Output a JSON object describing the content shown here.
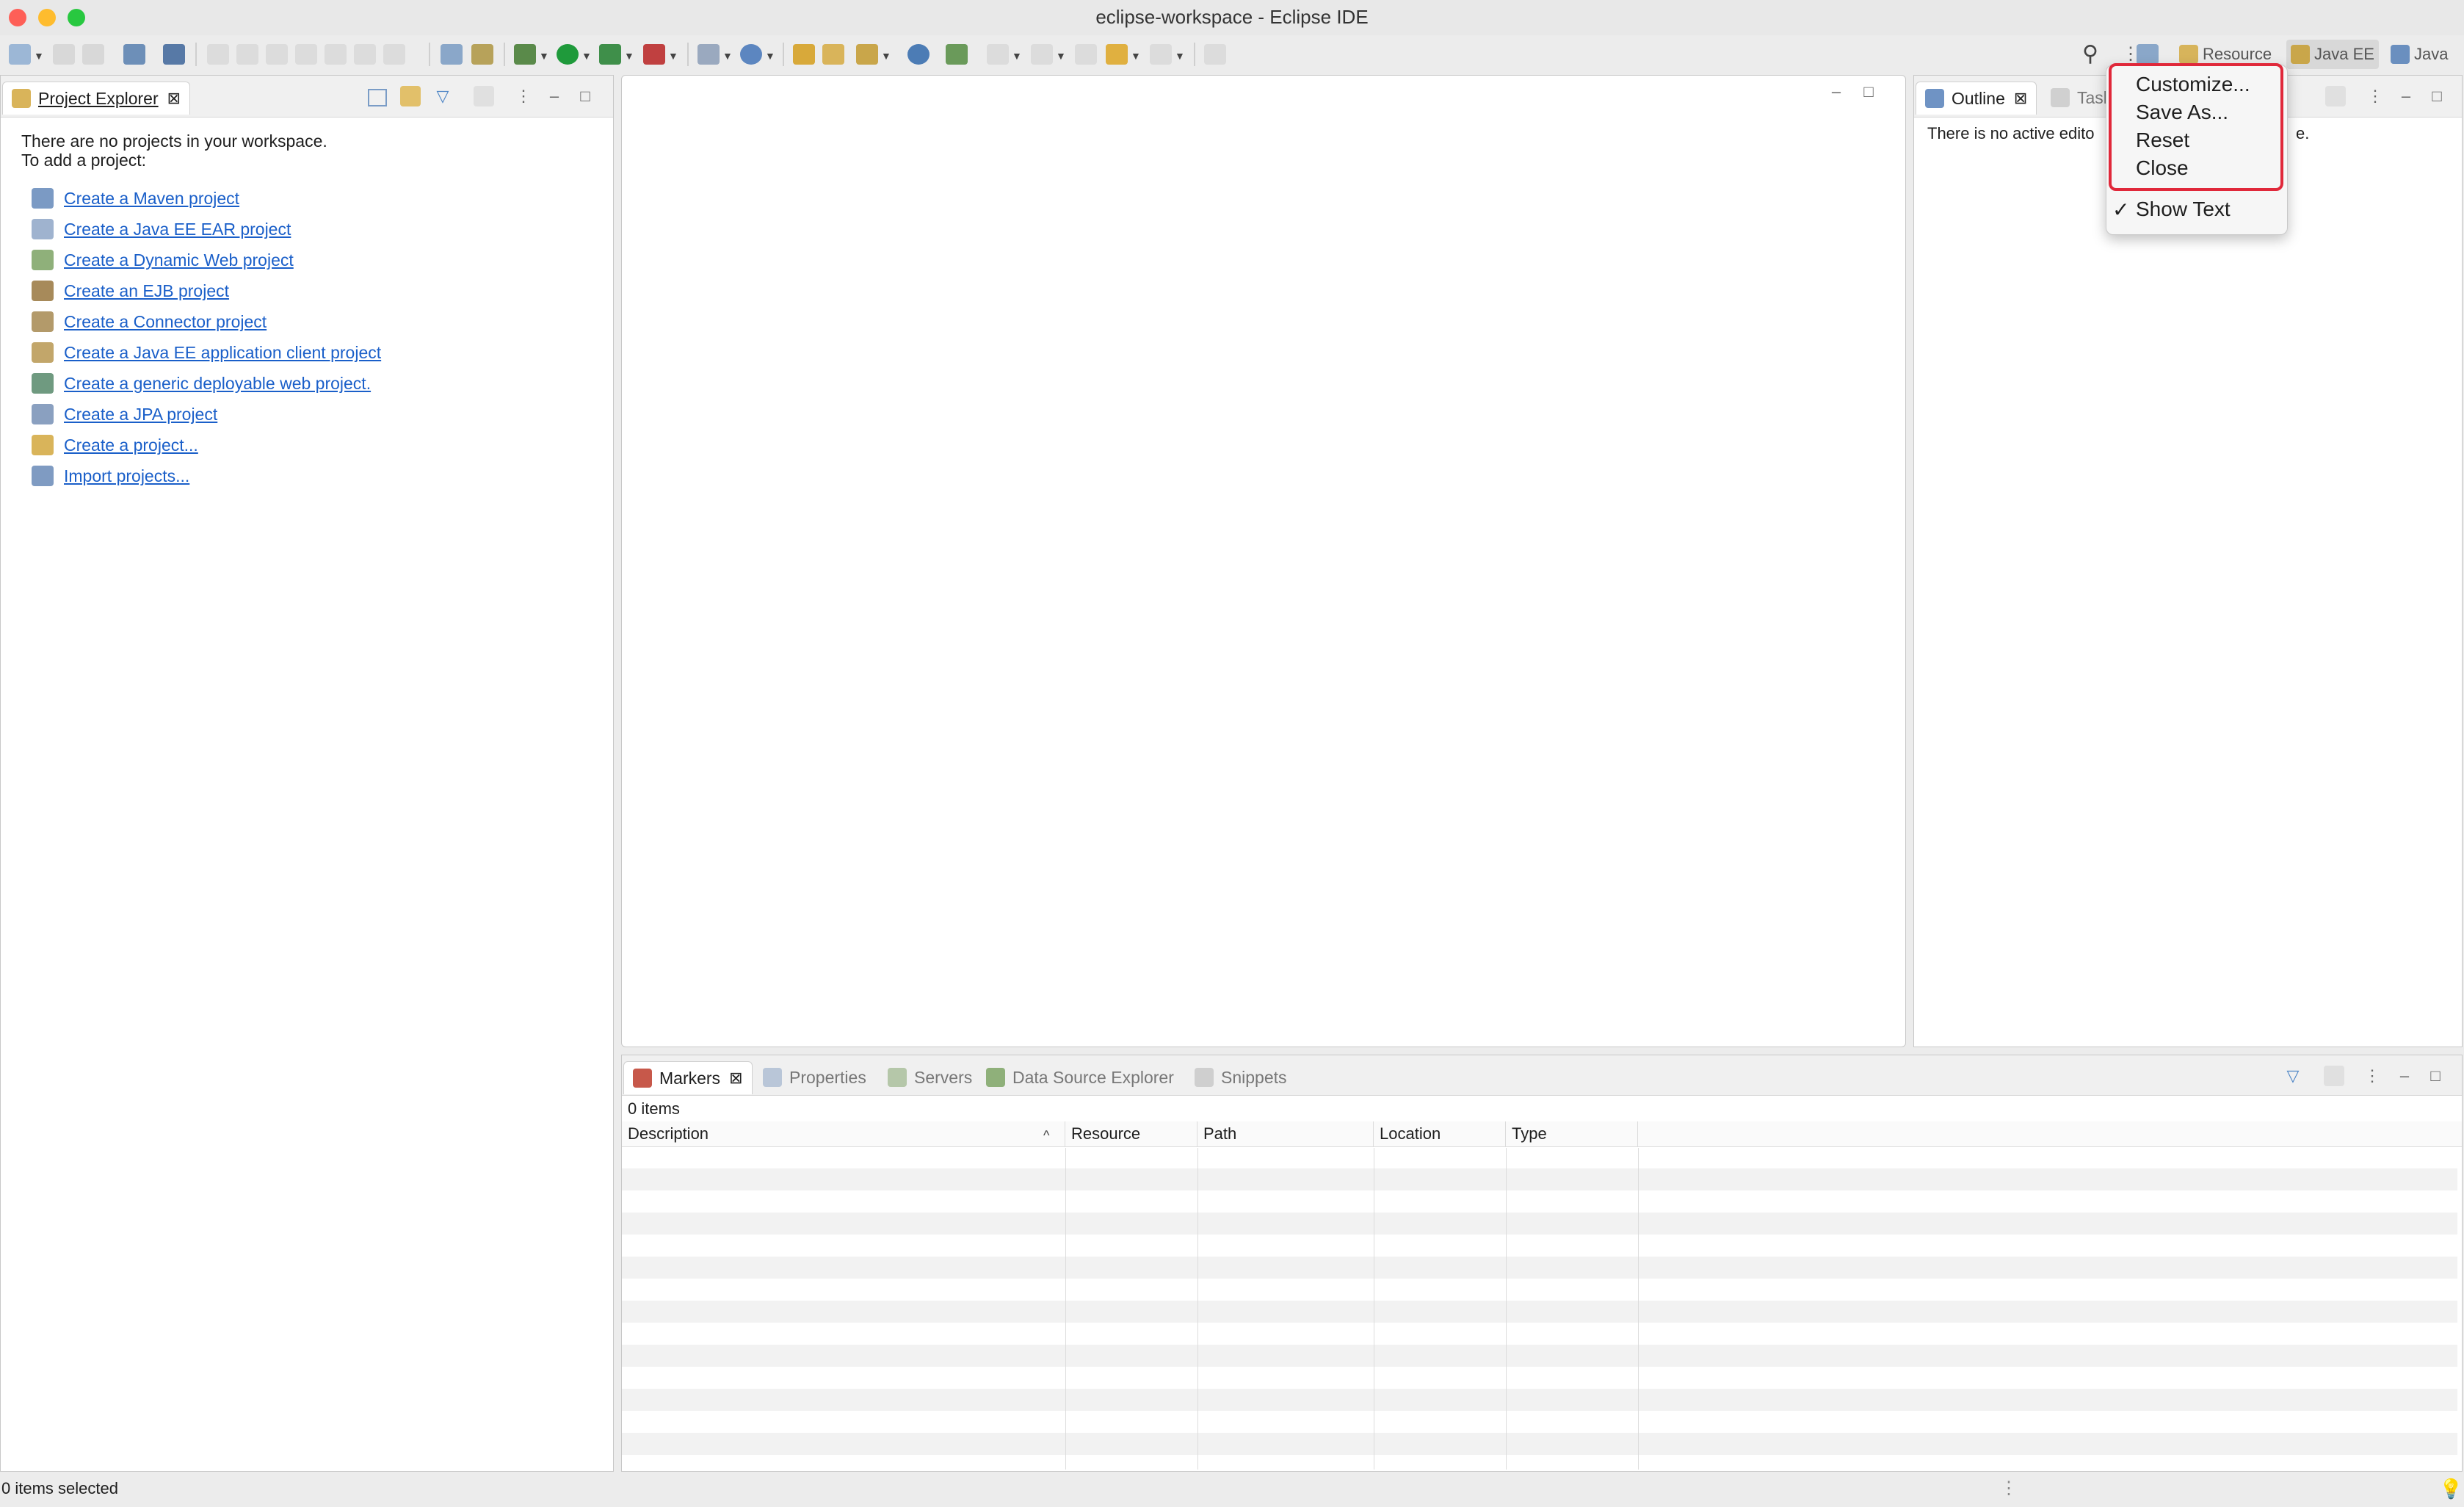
{
  "window": {
    "title": "eclipse-workspace - Eclipse IDE"
  },
  "perspectives": {
    "items": [
      {
        "label": "Resource",
        "icon": "resource-perspective-icon",
        "active": false
      },
      {
        "label": "Java EE",
        "icon": "javaee-perspective-icon",
        "active": true
      },
      {
        "label": "Java",
        "icon": "java-perspective-icon",
        "active": false
      }
    ]
  },
  "context_menu": {
    "items": [
      {
        "label": "Customize..."
      },
      {
        "label": "Save As..."
      },
      {
        "label": "Reset"
      },
      {
        "label": "Close"
      }
    ],
    "show_text": {
      "check": "✓",
      "label": "Show Text"
    }
  },
  "project_explorer": {
    "tab_label": "Project Explorer",
    "close_glyph": "⊠",
    "message_line1": "There are no projects in your workspace.",
    "message_line2": "To add a project:",
    "links": [
      "Create a Maven project",
      "Create a Java EE EAR project",
      "Create a Dynamic Web project",
      "Create an EJB project",
      "Create a Connector project",
      "Create a Java EE application client project",
      "Create a generic deployable web project.",
      "Create a JPA project",
      "Create a project...",
      "Import projects..."
    ]
  },
  "outline": {
    "tab_label": "Outline",
    "second_tab_label": "Tasl",
    "message_start": "There is no active edito",
    "message_end": "e."
  },
  "bottom_panel": {
    "tabs": [
      {
        "label": "Markers",
        "active": true
      },
      {
        "label": "Properties",
        "active": false
      },
      {
        "label": "Servers",
        "active": false
      },
      {
        "label": "Data Source Explorer",
        "active": false
      },
      {
        "label": "Snippets",
        "active": false
      }
    ],
    "items_count": "0 items",
    "columns": [
      "Description",
      "Resource",
      "Path",
      "Location",
      "Type"
    ],
    "sort_glyph": "^"
  },
  "status_bar": {
    "text": "0 items selected"
  },
  "colors": {
    "link": "#1a5fc9",
    "menu_highlight": "#e0283a",
    "traffic_red": "#fe5f57",
    "traffic_yellow": "#febc2e",
    "traffic_green": "#28c840"
  }
}
